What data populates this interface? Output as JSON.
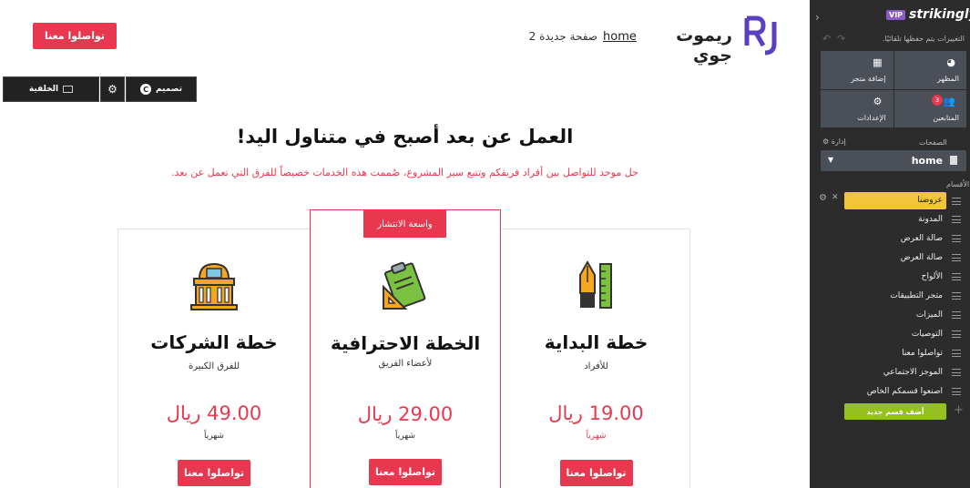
{
  "header": {
    "cta_label": "تواصلوا معنا",
    "site_title": "ريموت جوي",
    "nav": [
      "home",
      "صفحة جديدة 2"
    ]
  },
  "section_toolbar": {
    "background_label": "الخلفية",
    "design_label": "تصميم",
    "design_badge": "C"
  },
  "pricing": {
    "headline": "العمل عن بعد أصبح في متناول اليد!",
    "subtext": "حل موحد للتواصل بين أفراد فريقكم وتتبع سير المشروع، صُممت هذه الخدمات خصيصاً للفرق التي تعمل عن بعد.",
    "plans": [
      {
        "id": "biz",
        "title": "خطة الشركات",
        "subtitle": "للفرق الكبيرة",
        "price": "49.00 ريال",
        "period": "شهرياً",
        "cta": "تواصلوا معنا",
        "icon": "building-icon"
      },
      {
        "id": "pro",
        "title": "الخطة الاحترافية",
        "subtitle": "لأعضاء الفريق",
        "price": "29.00 ريال",
        "period": "شهرياً",
        "cta": "تواصلوا معنا",
        "icon": "clipboard-ruler-icon",
        "badge": "واسعة الانتشار"
      },
      {
        "id": "start",
        "title": "خطة البداية",
        "subtitle": "للأفراد",
        "price": "19.00 ريال",
        "period": "شهرياً",
        "cta": "تواصلوا معنا",
        "icon": "pen-ruler-icon"
      }
    ],
    "accent_color": "#e8384f"
  },
  "sidebar": {
    "brand_badge": "VIP",
    "brand_name": "strikingly",
    "autosave_text": "التغييرات يتم حفظها تلقائيًا.",
    "tiles": [
      {
        "label": "المظهر",
        "icon": "palette-icon"
      },
      {
        "label": "إضافة متجر",
        "icon": "store-icon"
      },
      {
        "label": "المتابعين",
        "icon": "users-icon",
        "badge": "3"
      },
      {
        "label": "الإعدادات",
        "icon": "gear-icon"
      }
    ],
    "pages_heading": "الصفحات",
    "manage_label": "إدارة",
    "current_page": "home",
    "sections_heading": "الأقسام",
    "sections": [
      "عروضنا",
      "المدونة",
      "صالة العرض",
      "صالة العرض",
      "الألواح",
      "متجر التطبيقات",
      "الميزات",
      "التوصيات",
      "تواصلوا معنا",
      "الموجز الاجتماعي",
      "اصنعوا قسمكم الخاص"
    ],
    "add_section_label": "أضف قسم جديد",
    "colors": {
      "panel": "#2c2c2c",
      "active_section": "#f0c53a",
      "add_button": "#94c11f",
      "vip": "#8b5cc7"
    }
  }
}
